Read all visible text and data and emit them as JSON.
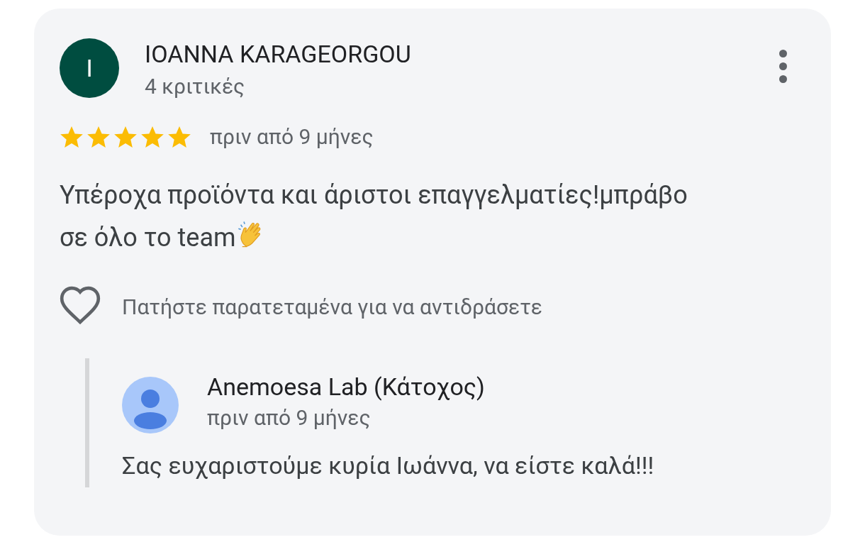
{
  "review": {
    "avatar_letter": "I",
    "author": "IOANNA KARAGEORGOU",
    "review_count": "4 κριτικές",
    "stars": 5,
    "time": "πριν από 9 μήνες",
    "text_lines": [
      "Υπέροχα προϊόντα και άριστοι επαγγελματίες!μπράβο",
      "σε όλο το team"
    ],
    "reaction_hint": "Πατήστε παρατεταμένα για να αντιδράσετε"
  },
  "reply": {
    "author": "Anemoesa Lab (Κάτοχος)",
    "time": "πριν από 9 μήνες",
    "text": "Σας ευχαριστούμε κυρία Ιωάννα, να είστε καλά!!!"
  }
}
